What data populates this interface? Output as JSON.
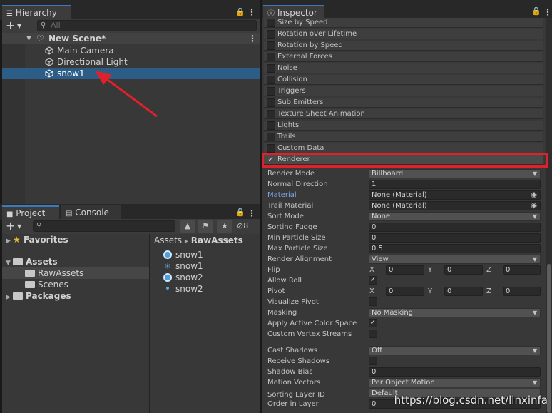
{
  "hierarchy": {
    "tab_title": "Hierarchy",
    "search_placeholder": "All",
    "scene_name": "New Scene*",
    "items": [
      {
        "label": "Main Camera"
      },
      {
        "label": "Directional Light"
      },
      {
        "label": "snow1"
      }
    ]
  },
  "project": {
    "tab_project": "Project",
    "tab_console": "Console",
    "hidden_count": "8",
    "tree": {
      "favorites": "Favorites",
      "assets": "Assets",
      "raw_assets": "RawAssets",
      "scenes": "Scenes",
      "packages": "Packages"
    },
    "breadcrumb": {
      "root": "Assets",
      "separator": "▸",
      "current": "RawAssets"
    },
    "files": [
      {
        "label": "snow1",
        "icon": "particle-system-icon"
      },
      {
        "label": "snow1",
        "icon": "material-icon"
      },
      {
        "label": "snow2",
        "icon": "particle-system-icon"
      },
      {
        "label": "snow2",
        "icon": "material-icon"
      }
    ]
  },
  "inspector": {
    "tab_title": "Inspector",
    "modules": [
      {
        "label": "Size by Speed"
      },
      {
        "label": "Rotation over Lifetime"
      },
      {
        "label": "Rotation by Speed"
      },
      {
        "label": "External Forces"
      },
      {
        "label": "Noise"
      },
      {
        "label": "Collision"
      },
      {
        "label": "Triggers"
      },
      {
        "label": "Sub Emitters"
      },
      {
        "label": "Texture Sheet Animation"
      },
      {
        "label": "Lights"
      },
      {
        "label": "Trails"
      },
      {
        "label": "Custom Data"
      }
    ],
    "renderer_label": "Renderer",
    "renderer": {
      "render_mode": {
        "label": "Render Mode",
        "value": "Billboard"
      },
      "normal_direction": {
        "label": "Normal Direction",
        "value": "1"
      },
      "material": {
        "label": "Material",
        "value": "None (Material)"
      },
      "trail_material": {
        "label": "Trail Material",
        "value": "None (Material)"
      },
      "sort_mode": {
        "label": "Sort Mode",
        "value": "None"
      },
      "sorting_fudge": {
        "label": "Sorting Fudge",
        "value": "0"
      },
      "min_particle_size": {
        "label": "Min Particle Size",
        "value": "0"
      },
      "max_particle_size": {
        "label": "Max Particle Size",
        "value": "0.5"
      },
      "render_alignment": {
        "label": "Render Alignment",
        "value": "View"
      },
      "flip": {
        "label": "Flip",
        "x": "0",
        "y": "0",
        "z": "0"
      },
      "allow_roll": {
        "label": "Allow Roll"
      },
      "pivot": {
        "label": "Pivot",
        "x": "0",
        "y": "0",
        "z": "0"
      },
      "visualize_pivot": {
        "label": "Visualize Pivot"
      },
      "masking": {
        "label": "Masking",
        "value": "No Masking"
      },
      "apply_active_color_space": {
        "label": "Apply Active Color Space"
      },
      "custom_vertex_streams": {
        "label": "Custom Vertex Streams"
      },
      "cast_shadows": {
        "label": "Cast Shadows",
        "value": "Off"
      },
      "receive_shadows": {
        "label": "Receive Shadows"
      },
      "shadow_bias": {
        "label": "Shadow Bias",
        "value": "0"
      },
      "motion_vectors": {
        "label": "Motion Vectors",
        "value": "Per Object Motion"
      },
      "sorting_layer_id": {
        "label": "Sorting Layer ID",
        "value": "Default"
      },
      "order_in_layer": {
        "label": "Order in Layer",
        "value": "0"
      }
    },
    "axis": {
      "x": "X",
      "y": "Y",
      "z": "Z"
    }
  },
  "watermark": "https://blog.csdn.net/linxinfa",
  "colors": {
    "selection": "#2c5d87",
    "highlight_box": "#e0202a",
    "arrow": "#e0202a",
    "material_label": "#7ca6e6"
  }
}
